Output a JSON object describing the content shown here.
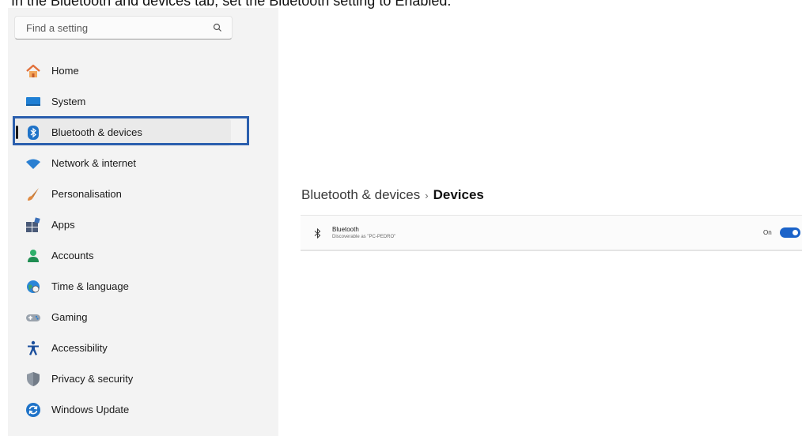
{
  "instruction": "In the Bluetooth and devices tab, set the Bluetooth setting to Enabled.",
  "search": {
    "placeholder": "Find a setting"
  },
  "sidebar": {
    "items": [
      {
        "label": "Home",
        "icon": "home-icon"
      },
      {
        "label": "System",
        "icon": "system-icon"
      },
      {
        "label": "Bluetooth & devices",
        "icon": "bluetooth-icon",
        "active": true
      },
      {
        "label": "Network & internet",
        "icon": "wifi-icon"
      },
      {
        "label": "Personalisation",
        "icon": "brush-icon"
      },
      {
        "label": "Apps",
        "icon": "apps-icon"
      },
      {
        "label": "Accounts",
        "icon": "account-icon"
      },
      {
        "label": "Time & language",
        "icon": "globe-clock-icon"
      },
      {
        "label": "Gaming",
        "icon": "gamepad-icon"
      },
      {
        "label": "Accessibility",
        "icon": "accessibility-icon"
      },
      {
        "label": "Privacy & security",
        "icon": "shield-icon"
      },
      {
        "label": "Windows Update",
        "icon": "update-icon"
      }
    ]
  },
  "breadcrumb": {
    "parent": "Bluetooth & devices",
    "separator": "›",
    "current": "Devices"
  },
  "bluetooth": {
    "title": "Bluetooth",
    "subtitle": "Discoverable as \"PC-PEDRO\"",
    "state_label": "On",
    "enabled": true
  },
  "colors": {
    "accent": "#1b63c9",
    "highlight_box": "#2b5fae",
    "sidebar_bg": "#f3f3f3"
  }
}
